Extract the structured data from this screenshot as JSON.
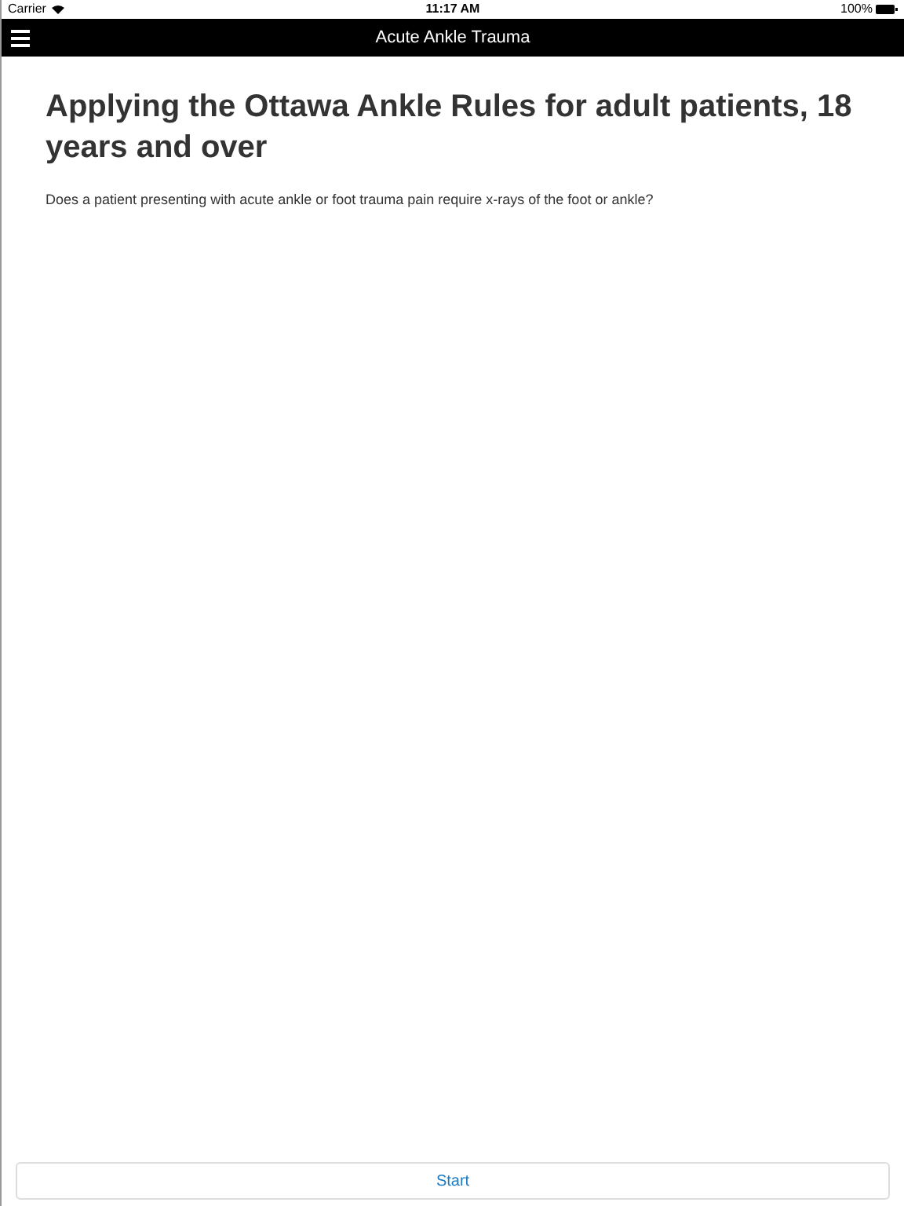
{
  "status_bar": {
    "carrier": "Carrier",
    "time": "11:17 AM",
    "battery": "100%"
  },
  "nav_bar": {
    "title": "Acute Ankle Trauma"
  },
  "content": {
    "heading": "Applying the Ottawa Ankle Rules for adult patients, 18 years and over",
    "question": "Does a patient presenting with acute ankle or foot trauma pain require x-rays of the foot or ankle?"
  },
  "buttons": [
    "Start"
  ]
}
